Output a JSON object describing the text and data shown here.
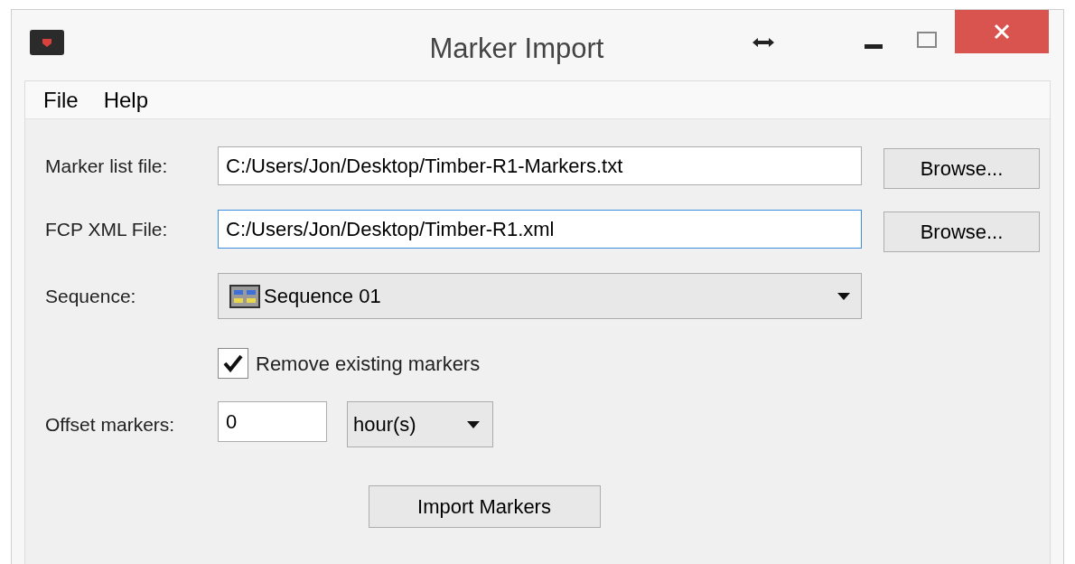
{
  "window": {
    "title": "Marker Import"
  },
  "menu": [
    "File",
    "Help"
  ],
  "file_rows": [
    {
      "label": "Marker list file:",
      "value": "C:/Users/Jon/Desktop/Timber-R1-Markers.txt",
      "focused": false,
      "button": "Browse..."
    },
    {
      "label": "FCP XML File:",
      "value": "C:/Users/Jon/Desktop/Timber-R1.xml",
      "focused": true,
      "button": "Browse..."
    }
  ],
  "sequence": {
    "label": "Sequence:",
    "value": "Sequence 01"
  },
  "remove_existing": {
    "label": "Remove existing markers",
    "checked": true
  },
  "offset": {
    "label": "Offset markers:",
    "value": "0",
    "unit": "hour(s)"
  },
  "import_button": "Import Markers"
}
